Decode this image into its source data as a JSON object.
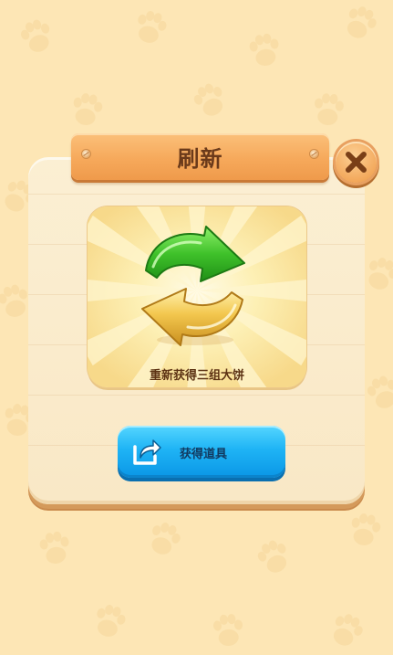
{
  "dialog": {
    "title": "刷新",
    "item_caption": "重新获得三组大饼",
    "item_icon": "refresh-arrows-icon",
    "action_button_label": "获得道具",
    "action_button_icon": "share-icon",
    "close_icon": "close-icon"
  },
  "colors": {
    "background": "#fde6b5",
    "panel": "#fbefd3",
    "title_plank": "#f6a95b",
    "title_text": "#6b3a1a",
    "action_button": "#1fb4f5",
    "arrow_green": "#3fc12a",
    "arrow_yellow": "#f3c74e"
  }
}
